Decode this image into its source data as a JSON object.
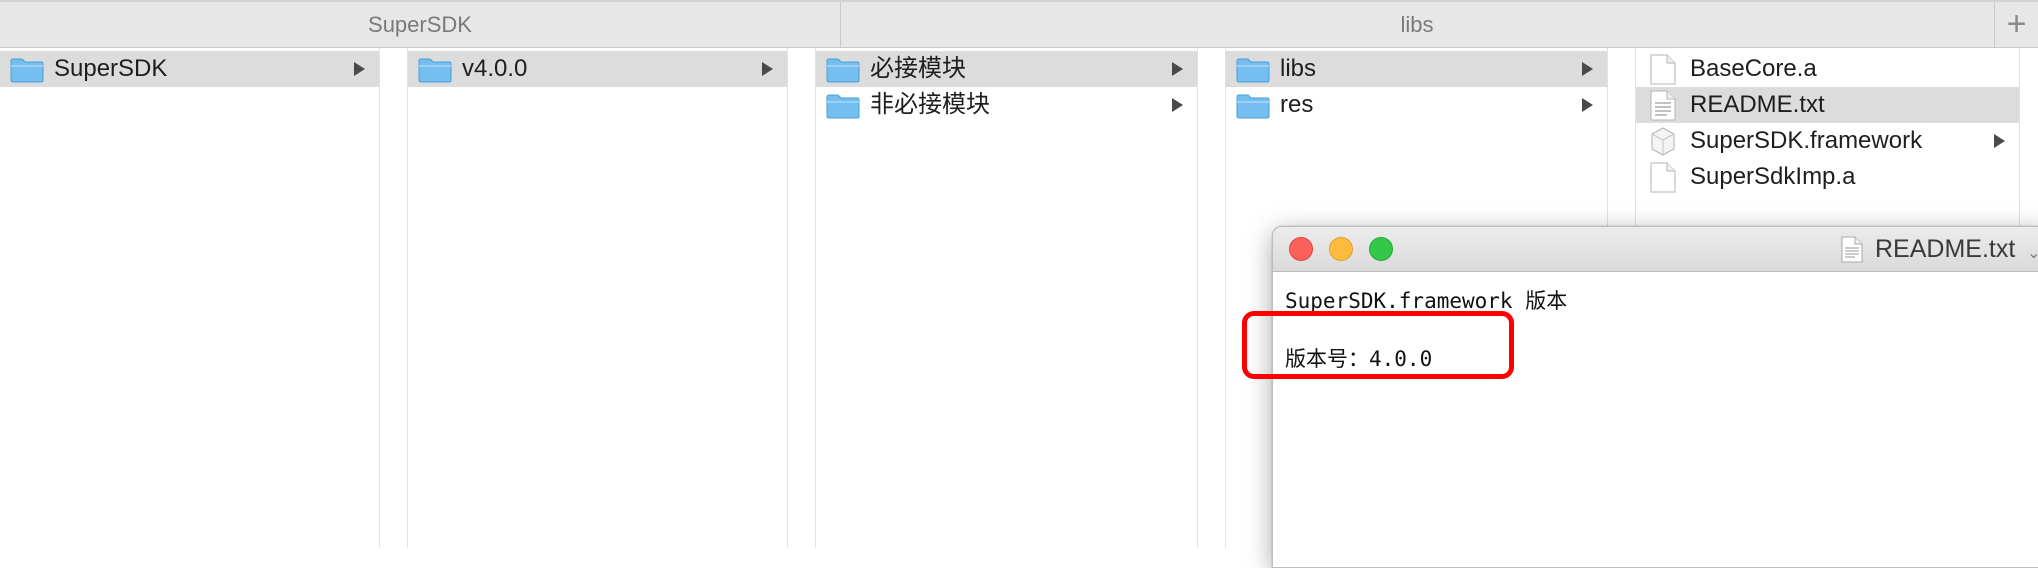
{
  "tabs": [
    "SuperSDK",
    "libs"
  ],
  "tab_add_icon": "plus-icon",
  "columns": [
    {
      "items": [
        {
          "label": "SuperSDK",
          "icon": "folder-icon",
          "selected": true,
          "arrow": true
        }
      ]
    },
    {
      "items": [
        {
          "label": "v4.0.0",
          "icon": "folder-icon",
          "selected": true,
          "arrow": true
        }
      ]
    },
    {
      "items": [
        {
          "label": "必接模块",
          "icon": "folder-icon",
          "selected": true,
          "arrow": true
        },
        {
          "label": "非必接模块",
          "icon": "folder-icon",
          "selected": false,
          "arrow": true
        }
      ]
    },
    {
      "items": [
        {
          "label": "libs",
          "icon": "folder-icon",
          "selected": true,
          "arrow": true
        },
        {
          "label": "res",
          "icon": "folder-icon",
          "selected": false,
          "arrow": true
        }
      ]
    },
    {
      "items": [
        {
          "label": "BaseCore.a",
          "icon": "file-icon",
          "selected": false,
          "arrow": false
        },
        {
          "label": "README.txt",
          "icon": "text-file-icon",
          "selected": true,
          "arrow": false
        },
        {
          "label": "SuperSDK.framework",
          "icon": "framework-icon",
          "selected": false,
          "arrow": true
        },
        {
          "label": "SuperSdkImp.a",
          "icon": "file-icon",
          "selected": false,
          "arrow": false
        }
      ]
    }
  ],
  "preview": {
    "title": "README.txt",
    "lines": [
      "SuperSDK.framework 版本",
      "版本号：4.0.0"
    ]
  },
  "colors": {
    "folder": "#74bff0",
    "selection": "#dcdcdc",
    "highlight": "#ff0000"
  }
}
